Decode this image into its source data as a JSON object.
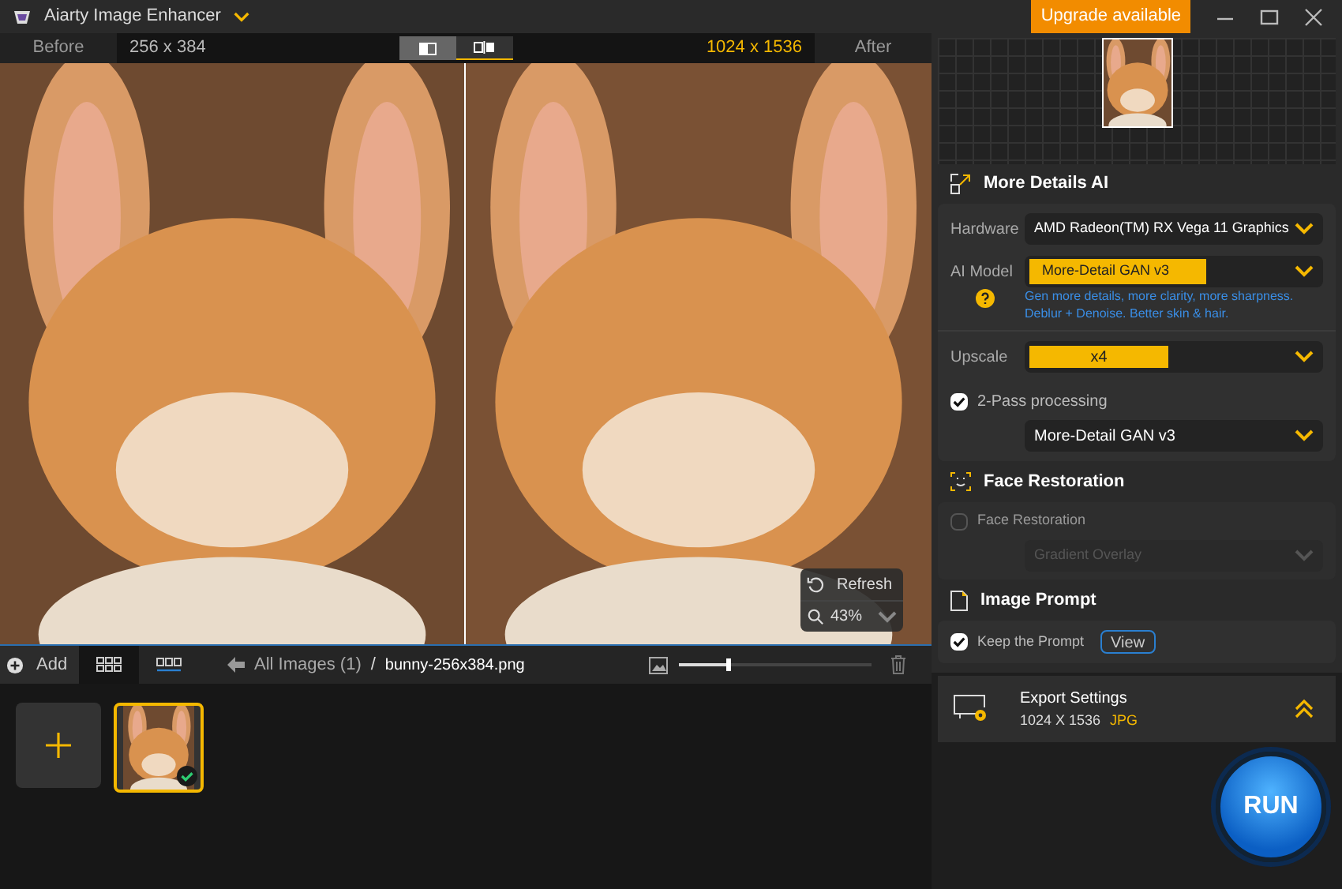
{
  "app": {
    "title": "Aiarty Image Enhancer",
    "upgrade": "Upgrade available"
  },
  "compare": {
    "before_label": "Before",
    "before_size": "256 x 384",
    "after_size": "1024 x 1536",
    "after_label": "After",
    "modes": [
      {
        "selected": false
      },
      {
        "selected": true
      }
    ]
  },
  "preview": {
    "refresh": "Refresh",
    "zoom": "43%"
  },
  "toolbar": {
    "add": "Add",
    "views": [
      {
        "selected": true
      },
      {
        "selected": false
      }
    ],
    "breadcrumb": "All Images (1)",
    "separator": "/",
    "file": "bunny-256x384.png",
    "thumb_size": {
      "level": 0.25
    }
  },
  "thumbnails": [
    {
      "selected": true,
      "done": true
    }
  ],
  "panel": {
    "more_details": {
      "title": "More Details AI",
      "hardware": {
        "label": "Hardware",
        "value": "AMD Radeon(TM) RX Vega 11 Graphics"
      },
      "ai_model": {
        "label": "AI Model",
        "value": "More-Detail GAN  v3",
        "description": [
          "Gen more details, more clarity, more sharpness.",
          "Deblur + Denoise. Better skin & hair."
        ]
      },
      "upscale": {
        "label": "Upscale",
        "value": "x4"
      },
      "two_pass": {
        "label": "2-Pass processing",
        "checked": true,
        "model": "More-Detail GAN  v3"
      }
    },
    "face": {
      "title": "Face Restoration",
      "checkbox": {
        "label": "Face Restoration",
        "checked": false
      },
      "model": "Gradient Overlay",
      "disabled": true
    },
    "prompt": {
      "title": "Image Prompt",
      "keep": {
        "label": "Keep the Prompt",
        "checked": true
      },
      "view": "View"
    },
    "export": {
      "title": "Export Settings",
      "size": "1024 X 1536",
      "format": "JPG"
    },
    "run": "RUN"
  }
}
